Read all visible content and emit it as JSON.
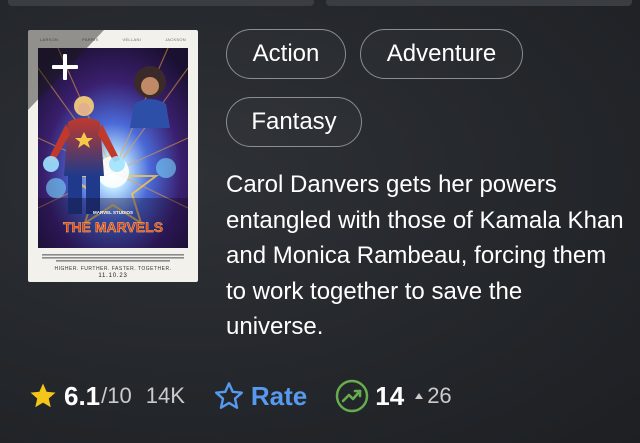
{
  "poster": {
    "credits": [
      "LARSON",
      "PARRIS",
      "VELLANI",
      "JACKSON"
    ],
    "studio": "MARVEL STUDIOS",
    "title": "THE MARVELS",
    "tagline": "HIGHER. FURTHER. FASTER. TOGETHER.",
    "date": "11.10.23"
  },
  "genres": [
    "Action",
    "Adventure",
    "Fantasy"
  ],
  "plot": "Carol Danvers gets her powers entangled with those of Kamala Khan and Monica Rambeau, forcing them to work together to save the universe.",
  "rating": {
    "value": "6.1",
    "scale": "/10",
    "count": "14K"
  },
  "rate_button": {
    "label": "Rate"
  },
  "popularity": {
    "value": "14",
    "change": "26"
  },
  "colors": {
    "star": "#f5c518",
    "rate_blue": "#5799ef",
    "trend_green": "#67ad4b",
    "chip_border": "#8a8d92"
  },
  "icons": {
    "watchlist": "plus-icon",
    "rating": "star-filled-icon",
    "rate": "star-outline-icon",
    "popularity": "trending-up-icon"
  }
}
